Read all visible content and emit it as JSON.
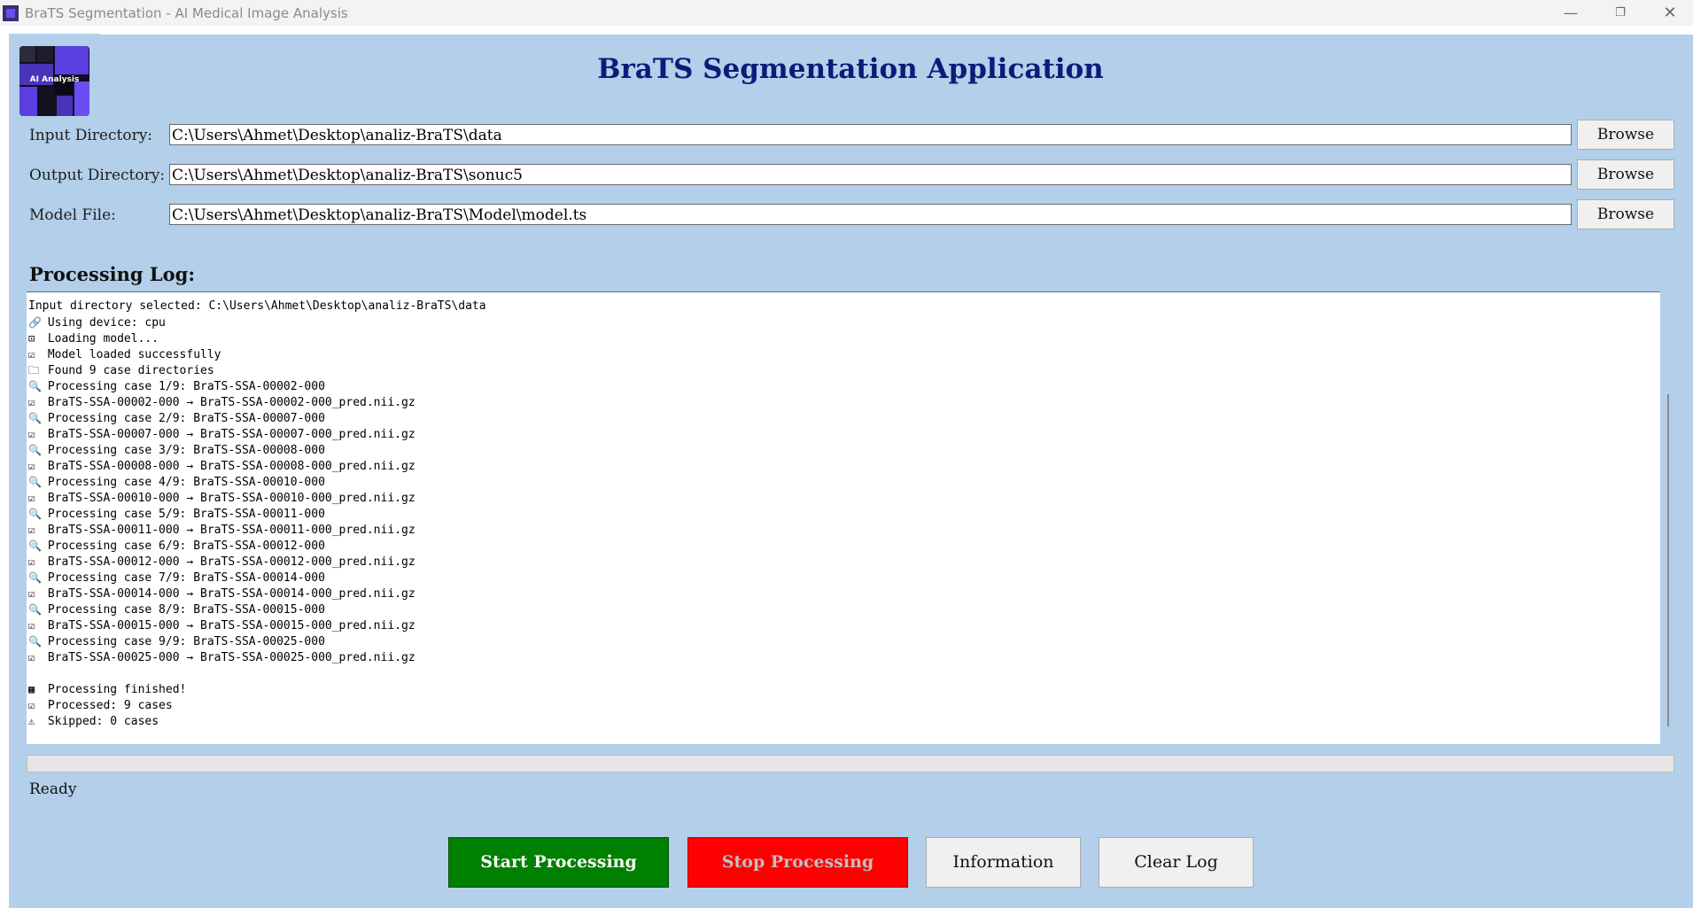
{
  "window": {
    "title": "BraTS Segmentation - AI Medical Image Analysis",
    "minimize_glyph": "—",
    "maximize_glyph": "❐",
    "close_glyph": "✕"
  },
  "header": {
    "logo_text": "AI Analysis",
    "title": "BraTS Segmentation Application"
  },
  "fields": [
    {
      "label": "Input Directory:",
      "value": "C:\\Users\\Ahmet\\Desktop\\analiz-BraTS\\data",
      "button": "Browse"
    },
    {
      "label": "Output Directory:",
      "value": "C:\\Users\\Ahmet\\Desktop\\analiz-BraTS\\sonuc5",
      "button": "Browse"
    },
    {
      "label": "Model File:",
      "value": "C:\\Users\\Ahmet\\Desktop\\analiz-BraTS\\Model\\model.ts",
      "button": "Browse"
    }
  ],
  "log": {
    "title": "Processing Log:",
    "lines": [
      {
        "icon": "",
        "text": "Input directory selected: C:\\Users\\Ahmet\\Desktop\\analiz-BraTS\\data"
      },
      {
        "icon": "🔗",
        "text": "Using device: cpu"
      },
      {
        "icon": "⊡",
        "text": "Loading model..."
      },
      {
        "icon": "☑",
        "text": "Model loaded successfully"
      },
      {
        "icon": "🗀",
        "text": "Found 9 case directories"
      },
      {
        "icon": "🔍",
        "text": "Processing case 1/9: BraTS-SSA-00002-000"
      },
      {
        "icon": "☑",
        "text": "BraTS-SSA-00002-000 → BraTS-SSA-00002-000_pred.nii.gz"
      },
      {
        "icon": "🔍",
        "text": "Processing case 2/9: BraTS-SSA-00007-000"
      },
      {
        "icon": "☑",
        "text": "BraTS-SSA-00007-000 → BraTS-SSA-00007-000_pred.nii.gz"
      },
      {
        "icon": "🔍",
        "text": "Processing case 3/9: BraTS-SSA-00008-000"
      },
      {
        "icon": "☑",
        "text": "BraTS-SSA-00008-000 → BraTS-SSA-00008-000_pred.nii.gz"
      },
      {
        "icon": "🔍",
        "text": "Processing case 4/9: BraTS-SSA-00010-000"
      },
      {
        "icon": "☑",
        "text": "BraTS-SSA-00010-000 → BraTS-SSA-00010-000_pred.nii.gz"
      },
      {
        "icon": "🔍",
        "text": "Processing case 5/9: BraTS-SSA-00011-000"
      },
      {
        "icon": "☑",
        "text": "BraTS-SSA-00011-000 → BraTS-SSA-00011-000_pred.nii.gz"
      },
      {
        "icon": "🔍",
        "text": "Processing case 6/9: BraTS-SSA-00012-000"
      },
      {
        "icon": "☑",
        "text": "BraTS-SSA-00012-000 → BraTS-SSA-00012-000_pred.nii.gz"
      },
      {
        "icon": "🔍",
        "text": "Processing case 7/9: BraTS-SSA-00014-000"
      },
      {
        "icon": "☑",
        "text": "BraTS-SSA-00014-000 → BraTS-SSA-00014-000_pred.nii.gz"
      },
      {
        "icon": "🔍",
        "text": "Processing case 8/9: BraTS-SSA-00015-000"
      },
      {
        "icon": "☑",
        "text": "BraTS-SSA-00015-000 → BraTS-SSA-00015-000_pred.nii.gz"
      },
      {
        "icon": "🔍",
        "text": "Processing case 9/9: BraTS-SSA-00025-000"
      },
      {
        "icon": "☑",
        "text": "BraTS-SSA-00025-000 → BraTS-SSA-00025-000_pred.nii.gz"
      },
      {
        "icon": "",
        "text": ""
      },
      {
        "icon": "▦",
        "text": "Processing finished!"
      },
      {
        "icon": "☑",
        "text": "Processed: 9 cases"
      },
      {
        "icon": "⚠",
        "text": "Skipped: 0 cases"
      }
    ]
  },
  "progress": {
    "fraction": 0
  },
  "status": "Ready",
  "buttons": {
    "start": "Start Processing",
    "stop": "Stop Processing",
    "info": "Information",
    "clear": "Clear Log"
  },
  "colors": {
    "client_bg": "#b3cfe9",
    "title": "#0c1b7a",
    "start_bg": "#008000",
    "stop_bg": "#ff0000"
  }
}
